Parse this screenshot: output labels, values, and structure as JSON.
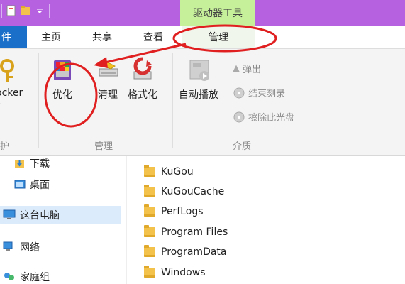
{
  "context_tab": {
    "label": "驱动器工具"
  },
  "tabs": [
    {
      "label": "件"
    },
    {
      "label": "主页"
    },
    {
      "label": "共享"
    },
    {
      "label": "查看"
    },
    {
      "label": "管理"
    }
  ],
  "ribbon": {
    "protect": {
      "bitlocker_label": "ocker",
      "group_label": "护"
    },
    "manage": {
      "optimize_label": "优化",
      "cleanup_label": "清理",
      "format_label": "格式化",
      "group_label": "管理"
    },
    "media": {
      "autoplay_label": "自动播放",
      "eject_label": "弹出",
      "finish_burn_label": "结束刻录",
      "erase_label": "擦除此光盘",
      "group_label": "介质"
    }
  },
  "nav": {
    "items": [
      {
        "label": "下载"
      },
      {
        "label": "桌面"
      },
      {
        "label": "这台电脑"
      },
      {
        "label": "网络"
      },
      {
        "label": "家庭组"
      }
    ]
  },
  "files": [
    {
      "name": "KuGou"
    },
    {
      "name": "KuGouCache"
    },
    {
      "name": "PerfLogs"
    },
    {
      "name": "Program Files"
    },
    {
      "name": "ProgramData"
    },
    {
      "name": "Windows"
    }
  ],
  "colors": {
    "titlebar": "#b561e0",
    "context_tab": "#c7f09a",
    "file_tab": "#1a6fc9",
    "annotation": "#e02020"
  }
}
